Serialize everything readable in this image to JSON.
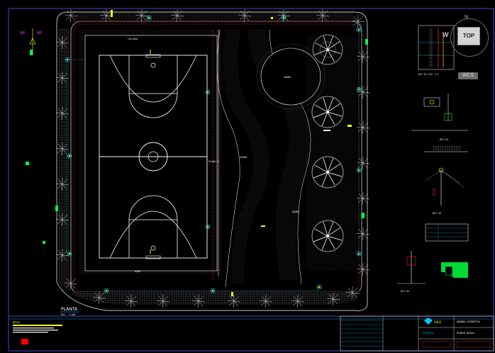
{
  "drawing": {
    "north_labels": {
      "nv": "NV",
      "np": "NP"
    },
    "plan_label": "PLANTA",
    "plan_scale": "ESC. 1:100",
    "zones": {
      "court_center": "PLANO 0",
      "path_label": "GRAMA",
      "lawn_a": "GRAMA",
      "lawn_b": "GRAMA",
      "paving": "CALÇADA",
      "curb": "MURO"
    },
    "details": {
      "detail_1": "DET-01 ESC 1:5",
      "detail_2": "DET-02",
      "detail_3": "DET-03",
      "detail_4": "DET-04"
    },
    "title_block": {
      "company": "VALE",
      "project": "QUADRA ESPORTIVA",
      "sheet": "PLANTA BAIXA",
      "discipline": "ELETRICA"
    },
    "notes_label": "NOTAS"
  },
  "viewcube": {
    "face": "TOP",
    "north": "N",
    "west": "W",
    "wcs": "WCS"
  },
  "colors": {
    "background": "#000000",
    "boundary": "#ffffff",
    "wall": "#ff2020",
    "conduit": "#00c8ff",
    "fixture": "#ffff00",
    "equipment": "#00ff40",
    "vegetation": "#bfbfbf",
    "hatch": "#9a9a9a",
    "magenta": "#ff40ff"
  },
  "icons": {
    "viewcube": "viewcube-icon",
    "tree": "tree-icon",
    "lamp": "lamp-icon"
  }
}
